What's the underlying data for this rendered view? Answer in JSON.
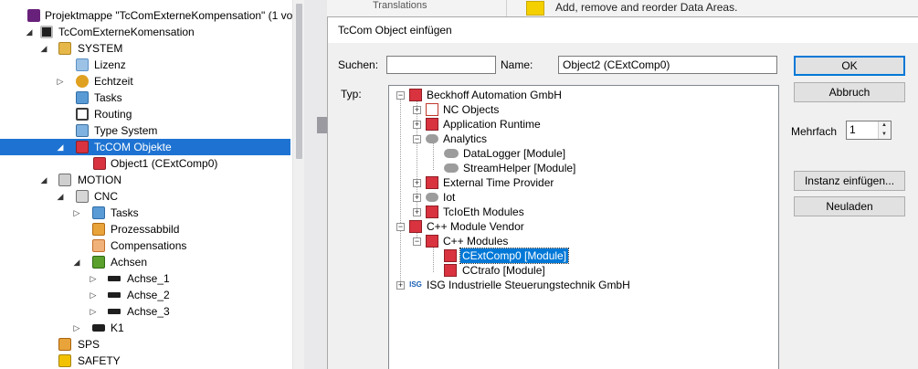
{
  "explorer": {
    "items": [
      {
        "label": "Projektmappe \"TcComExterneKompensation\" (1 vo",
        "icon": "solution-icon"
      },
      {
        "label": "TcComExterneKomensation",
        "icon": "project-icon"
      },
      {
        "label": "SYSTEM",
        "icon": "system-icon"
      },
      {
        "label": "Lizenz",
        "icon": "license-icon"
      },
      {
        "label": "Echtzeit",
        "icon": "realtime-icon"
      },
      {
        "label": "Tasks",
        "icon": "tasks-icon"
      },
      {
        "label": "Routing",
        "icon": "routing-icon"
      },
      {
        "label": "Type System",
        "icon": "type-system-icon"
      },
      {
        "label": "TcCOM Objekte",
        "icon": "tccom-icon"
      },
      {
        "label": "Object1 (CExtComp0)",
        "icon": "module-icon"
      },
      {
        "label": "MOTION",
        "icon": "motion-icon"
      },
      {
        "label": "CNC",
        "icon": "cnc-icon"
      },
      {
        "label": "Tasks",
        "icon": "tasks-icon"
      },
      {
        "label": "Prozessabbild",
        "icon": "process-image-icon"
      },
      {
        "label": "Compensations",
        "icon": "compensations-icon"
      },
      {
        "label": "Achsen",
        "icon": "axes-icon"
      },
      {
        "label": "Achse_1",
        "icon": "axis-icon"
      },
      {
        "label": "Achse_2",
        "icon": "axis-icon"
      },
      {
        "label": "Achse_3",
        "icon": "axis-icon"
      },
      {
        "label": "K1",
        "icon": "channel-icon"
      },
      {
        "label": "SPS",
        "icon": "plc-icon"
      },
      {
        "label": "SAFETY",
        "icon": "safety-icon"
      }
    ]
  },
  "background": {
    "partial_text": "Translations",
    "hint_text": "Add, remove and reorder Data Areas."
  },
  "dialog": {
    "title": "TcCom Object einfügen",
    "search_label": "Suchen:",
    "search_value": "",
    "name_label": "Name:",
    "name_value": "Object2 (CExtComp0)",
    "type_label": "Typ:",
    "ok_label": "OK",
    "cancel_label": "Abbruch",
    "multiple_label": "Mehrfach",
    "multiple_value": "1",
    "insert_instance_label": "Instanz einfügen...",
    "reload_label": "Neuladen",
    "tree": [
      {
        "label": "Beckhoff Automation GmbH",
        "icon": "tccom-icon"
      },
      {
        "label": "NC Objects",
        "icon": "nc-objects-icon"
      },
      {
        "label": "Application Runtime",
        "icon": "tccom-icon"
      },
      {
        "label": "Analytics",
        "icon": "cloud-icon"
      },
      {
        "label": "DataLogger [Module]",
        "icon": "cloud-icon"
      },
      {
        "label": "StreamHelper [Module]",
        "icon": "cloud-icon"
      },
      {
        "label": "External Time Provider",
        "icon": "tccom-icon"
      },
      {
        "label": "Iot",
        "icon": "cloud-icon"
      },
      {
        "label": "TcIoEth Modules",
        "icon": "tccom-icon"
      },
      {
        "label": "C++ Module Vendor",
        "icon": "tccom-icon"
      },
      {
        "label": "C++ Modules",
        "icon": "tccom-icon"
      },
      {
        "label": "CExtComp0 [Module]",
        "icon": "tccom-icon"
      },
      {
        "label": "CCtrafo [Module]",
        "icon": "tccom-icon"
      },
      {
        "label": "ISG Industrielle Steuerungstechnik GmbH",
        "icon": "isg-logo-icon",
        "logo_text": "ISG"
      }
    ]
  },
  "colors": {
    "selection": "#1e73d2",
    "tree_selection": "#0078d7",
    "tccom_red": "#d9333f",
    "default_button_border": "#0078d7"
  }
}
